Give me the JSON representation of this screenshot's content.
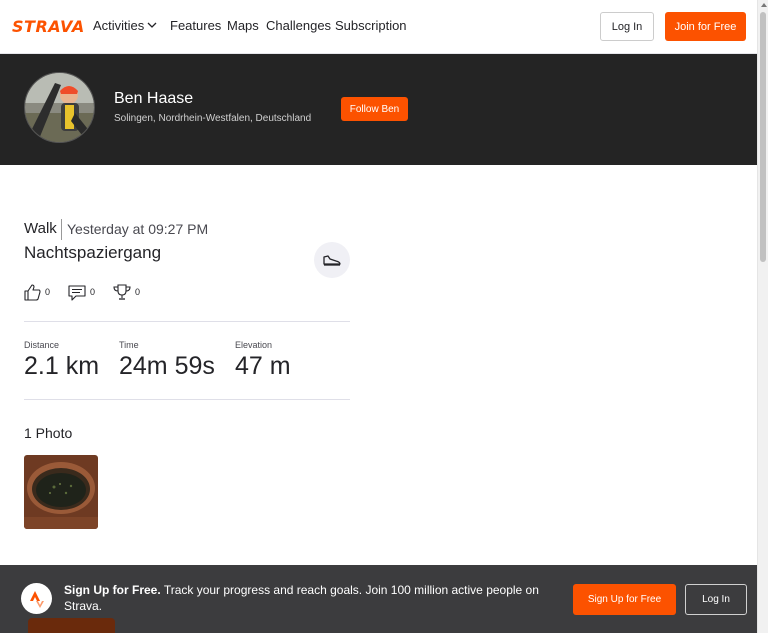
{
  "nav": {
    "logo": "STRAVA",
    "items": [
      "Activities",
      "Features",
      "Maps",
      "Challenges",
      "Subscription"
    ],
    "login_label": "Log In",
    "join_label": "Join for Free"
  },
  "athlete": {
    "name": "Ben Haase",
    "location": "Solingen, Nordrhein-Westfalen, Deutschland",
    "follow_label": "Follow Ben"
  },
  "activity": {
    "type": "Walk",
    "date": "Yesterday at 09:27 PM",
    "title": "Nachtspaziergang",
    "sport_icon": "shoe-icon",
    "kudos": "0",
    "comments": "0",
    "achievements": "0",
    "stats": [
      {
        "label": "Distance",
        "value": "2.1 km"
      },
      {
        "label": "Time",
        "value": "24m 59s"
      },
      {
        "label": "Elevation",
        "value": "47 m"
      }
    ],
    "photos_title": "1 Photo"
  },
  "banner": {
    "headline": "Sign Up for Free.",
    "text": "Track your progress and reach goals. Join 100 million active people on Strava.",
    "signup_label": "Sign Up for Free",
    "login_label": "Log In"
  },
  "colors": {
    "brand": "#fc5200",
    "header_bg": "#242424",
    "banner_bg": "#3c3c3e"
  }
}
